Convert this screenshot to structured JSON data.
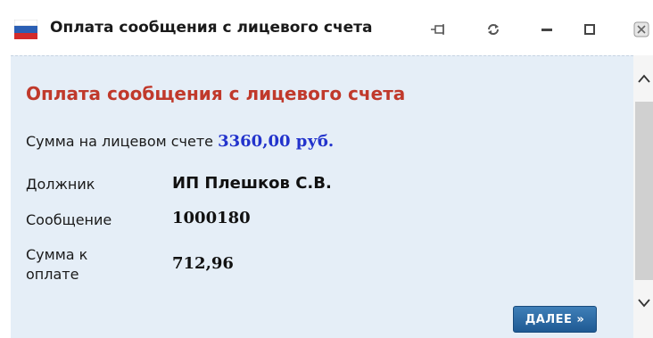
{
  "window": {
    "title": "Оплата сообщения с лицевого счета",
    "buttons": {
      "pin": "pin-icon",
      "refresh": "refresh-icon",
      "minimize": "minimize-icon",
      "maximize": "maximize-icon",
      "close": "close-icon"
    }
  },
  "form": {
    "heading": "Оплата сообщения с лицевого счета",
    "balance_label": "Сумма на лицевом счете",
    "balance_value": "3360,00 руб.",
    "rows": [
      {
        "label": "Должник",
        "value": "ИП Плешков С.В."
      },
      {
        "label": "Сообщение",
        "value": "1000180"
      },
      {
        "label": "Сумма к оплате",
        "value": "712,96"
      }
    ],
    "next_label": "ДАЛЕЕ",
    "next_chevron": "»"
  },
  "colors": {
    "heading": "#c0392b",
    "balance": "#2233cc",
    "content_bg": "#e5eef7",
    "button": "#2a6aa6"
  }
}
